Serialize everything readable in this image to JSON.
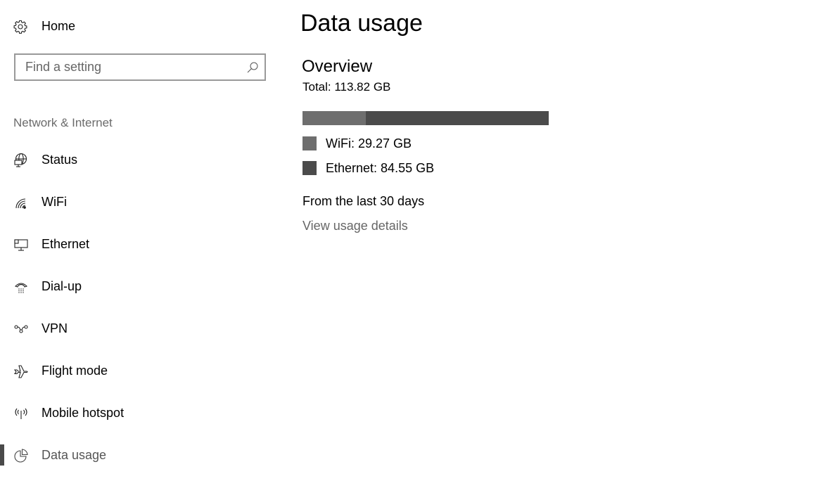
{
  "sidebar": {
    "home": {
      "label": "Home",
      "icon": "gear-icon"
    },
    "search": {
      "placeholder": "Find a setting",
      "value": "",
      "icon": "search-icon"
    },
    "section_label": "Network & Internet",
    "items": [
      {
        "label": "Status",
        "icon": "globe-monitor-icon",
        "active": false
      },
      {
        "label": "WiFi",
        "icon": "wifi-icon",
        "active": false
      },
      {
        "label": "Ethernet",
        "icon": "ethernet-icon",
        "active": false
      },
      {
        "label": "Dial-up",
        "icon": "phone-icon",
        "active": false
      },
      {
        "label": "VPN",
        "icon": "vpn-icon",
        "active": false
      },
      {
        "label": "Flight mode",
        "icon": "airplane-icon",
        "active": false
      },
      {
        "label": "Mobile hotspot",
        "icon": "hotspot-icon",
        "active": false
      },
      {
        "label": "Data usage",
        "icon": "pie-chart-icon",
        "active": true
      }
    ]
  },
  "main": {
    "title": "Data usage",
    "overview": {
      "heading": "Overview",
      "total": "Total: 113.82 GB",
      "segments": [
        {
          "name": "WiFi",
          "label": "WiFi: 29.27 GB",
          "value_gb": 29.27,
          "color": "#6e6e6e"
        },
        {
          "name": "Ethernet",
          "label": "Ethernet: 84.55 GB",
          "value_gb": 84.55,
          "color": "#4b4b4b"
        }
      ],
      "period": "From the last 30 days",
      "details_link": "View usage details"
    }
  },
  "colors": {
    "accent_indicator": "#4a4a4a",
    "secondary_text": "#6b6b6b",
    "search_border": "#999999"
  }
}
